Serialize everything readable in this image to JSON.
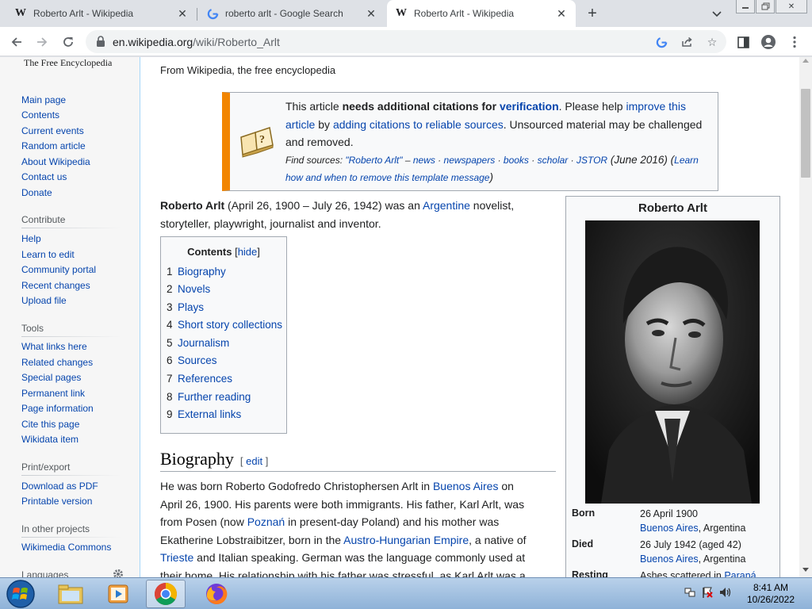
{
  "tabs": [
    {
      "title": "Roberto Arlt - Wikipedia",
      "favicon": "W",
      "active": false
    },
    {
      "title": "roberto arlt - Google Search",
      "favicon": "G",
      "active": false
    },
    {
      "title": "Roberto Arlt - Wikipedia",
      "favicon": "W",
      "active": true
    }
  ],
  "address": {
    "host": "en.wikipedia.org",
    "path": "/wiki/Roberto_Arlt"
  },
  "sidebar": {
    "tagline": "The Free Encyclopedia",
    "nav": [
      "Main page",
      "Contents",
      "Current events",
      "Random article",
      "About Wikipedia",
      "Contact us",
      "Donate"
    ],
    "contribute_heading": "Contribute",
    "contribute": [
      "Help",
      "Learn to edit",
      "Community portal",
      "Recent changes",
      "Upload file"
    ],
    "tools_heading": "Tools",
    "tools": [
      "What links here",
      "Related changes",
      "Special pages",
      "Permanent link",
      "Page information",
      "Cite this page",
      "Wikidata item"
    ],
    "print_heading": "Print/export",
    "print": [
      "Download as PDF",
      "Printable version"
    ],
    "projects_heading": "In other projects",
    "projects": [
      "Wikimedia Commons"
    ],
    "languages_heading": "Languages"
  },
  "article": {
    "from": "From Wikipedia, the free encyclopedia",
    "notice": {
      "t1": "This article ",
      "t2": "needs additional citations for ",
      "t3": "verification",
      "t4": ". Please help ",
      "t5": "improve this article",
      "t6": " by ",
      "t7": "adding citations to reliable sources",
      "t8": ". Unsourced material may be challenged and removed.",
      "find_label": "Find sources: ",
      "find_query": "\"Roberto Arlt\"",
      "find_dash": " – ",
      "sources": [
        "news",
        "newspapers",
        "books",
        "scholar",
        "JSTOR"
      ],
      "date": " (June 2016) ",
      "learn": "Learn how and when to remove this template message"
    },
    "lead": {
      "name": "Roberto Arlt",
      "l1": " (April 26, 1900 – July 26, 1942) was an ",
      "link": "Argentine",
      "l2": " novelist, storyteller, playwright, journalist and inventor."
    },
    "toc": {
      "title": "Contents",
      "hide": "hide",
      "items": [
        {
          "num": "1",
          "label": "Biography"
        },
        {
          "num": "2",
          "label": "Novels"
        },
        {
          "num": "3",
          "label": "Plays"
        },
        {
          "num": "4",
          "label": "Short story collections"
        },
        {
          "num": "5",
          "label": "Journalism"
        },
        {
          "num": "6",
          "label": "Sources"
        },
        {
          "num": "7",
          "label": "References"
        },
        {
          "num": "8",
          "label": "Further reading"
        },
        {
          "num": "9",
          "label": "External links"
        }
      ]
    },
    "section_heading": "Biography",
    "edit_label": "edit",
    "bio": {
      "b1": "He was born Roberto Godofredo Christophersen Arlt in ",
      "l_ba": "Buenos Aires",
      "b2": " on April 26, 1900. His parents were both immigrants. His father, Karl Arlt, was from Posen (now ",
      "l_poznan": "Poznań",
      "b3": " in present-day Poland) and his mother was Ekatherine Lobstraibitzer, born in the ",
      "l_ahe": "Austro-Hungarian Empire",
      "b4": ", a native of ",
      "l_trieste": "Trieste",
      "b5": " and Italian speaking. German was the language commonly used at their home. His relationship with his father was stressful, as Karl Arlt was a very severe and"
    }
  },
  "infobox": {
    "title": "Roberto Arlt",
    "born_label": "Born",
    "born_date": "26 April 1900",
    "born_place_link": "Buenos Aires",
    "born_place_rest": ", Argentina",
    "died_label": "Died",
    "died_date": "26 July 1942 (aged 42)",
    "died_place_link": "Buenos Aires",
    "died_place_rest": ", Argentina",
    "resting_label": "Resting",
    "resting_text": "Ashes scattered in ",
    "resting_link": "Paraná"
  },
  "taskbar": {
    "time": "8:41 AM",
    "date": "10/26/2022"
  },
  "colors": {
    "link": "#0645ad",
    "notice_bar": "#f28500",
    "tab_strip": "#dee1e6"
  }
}
